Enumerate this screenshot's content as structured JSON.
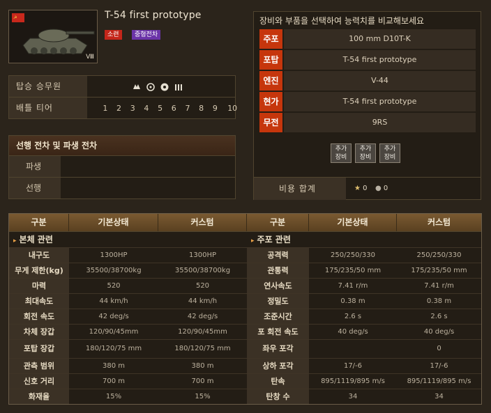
{
  "tank": {
    "name": "T-54 first prototype",
    "tier_roman": "Ⅷ",
    "nation_badge": "소련",
    "class_badge": "중형전차"
  },
  "crew": {
    "label": "탑승 승무원",
    "icons": [
      "commander-icon",
      "gunner-icon",
      "driver-icon",
      "radioman-icon",
      "loader-icon"
    ]
  },
  "battle_tier": {
    "label": "배틀 티어",
    "tiers": [
      "1",
      "2",
      "3",
      "4",
      "5",
      "6",
      "7",
      "8",
      "9",
      "10"
    ]
  },
  "tree": {
    "title": "선행 전차 및 파생 전차",
    "derived_label": "파생",
    "preceding_label": "선행"
  },
  "compare": {
    "title": "장비와 부품을 선택하여 능력치를 비교해보세요",
    "modules": [
      {
        "tag": "주포",
        "value": "100 mm D10T-K"
      },
      {
        "tag": "포탑",
        "value": "T-54 first prototype"
      },
      {
        "tag": "엔진",
        "value": "V-44"
      },
      {
        "tag": "현가",
        "value": "T-54 first prototype"
      },
      {
        "tag": "무전",
        "value": "9RS"
      }
    ],
    "add_button": [
      "추가",
      "장비"
    ],
    "cost_label": "비용 합계",
    "gold": "0",
    "credits": "0"
  },
  "stats": {
    "headers": [
      "구분",
      "기본상태",
      "커스텀",
      "구분",
      "기본상태",
      "커스텀"
    ],
    "left_section": "본체 관련",
    "right_section": "주포 관련",
    "rows": [
      {
        "l": "내구도",
        "lb": "1300HP",
        "lc": "1300HP",
        "r": "공격력",
        "rb": "250/250/330",
        "rc": "250/250/330"
      },
      {
        "l": "무게 제한(kg)",
        "lb": "35500/38700kg",
        "lc": "35500/38700kg",
        "r": "관통력",
        "rb": "175/235/50 mm",
        "rc": "175/235/50 mm"
      },
      {
        "l": "마력",
        "lb": "520",
        "lc": "520",
        "r": "연사속도",
        "rb": "7.41 r/m",
        "rc": "7.41 r/m"
      },
      {
        "l": "최대속도",
        "lb": "44 km/h",
        "lc": "44 km/h",
        "r": "정밀도",
        "rb": "0.38 m",
        "rc": "0.38 m"
      },
      {
        "l": "회전 속도",
        "lb": "42 deg/s",
        "lc": "42 deg/s",
        "r": "조준시간",
        "rb": "2.6 s",
        "rc": "2.6 s"
      },
      {
        "l": "차체 장갑",
        "lb": "120/90/45mm",
        "lc": "120/90/45mm",
        "r": "포 회전 속도",
        "rb": "40 deg/s",
        "rc": "40 deg/s"
      },
      {
        "l": "포탑 장갑",
        "lb": "180/120/75 mm",
        "lc": "180/120/75 mm",
        "r": "좌우 포각",
        "rb": "",
        "rc": "0"
      },
      {
        "l": "관측 범위",
        "lb": "380 m",
        "lc": "380 m",
        "r": "상하 포각",
        "rb": "17/-6",
        "rc": "17/-6"
      },
      {
        "l": "신호 거리",
        "lb": "700 m",
        "lc": "700 m",
        "r": "탄속",
        "rb": "895/1119/895 m/s",
        "rc": "895/1119/895 m/s"
      },
      {
        "l": "화재율",
        "lb": "15%",
        "lc": "15%",
        "r": "탄창 수",
        "rb": "34",
        "rc": "34"
      }
    ]
  }
}
